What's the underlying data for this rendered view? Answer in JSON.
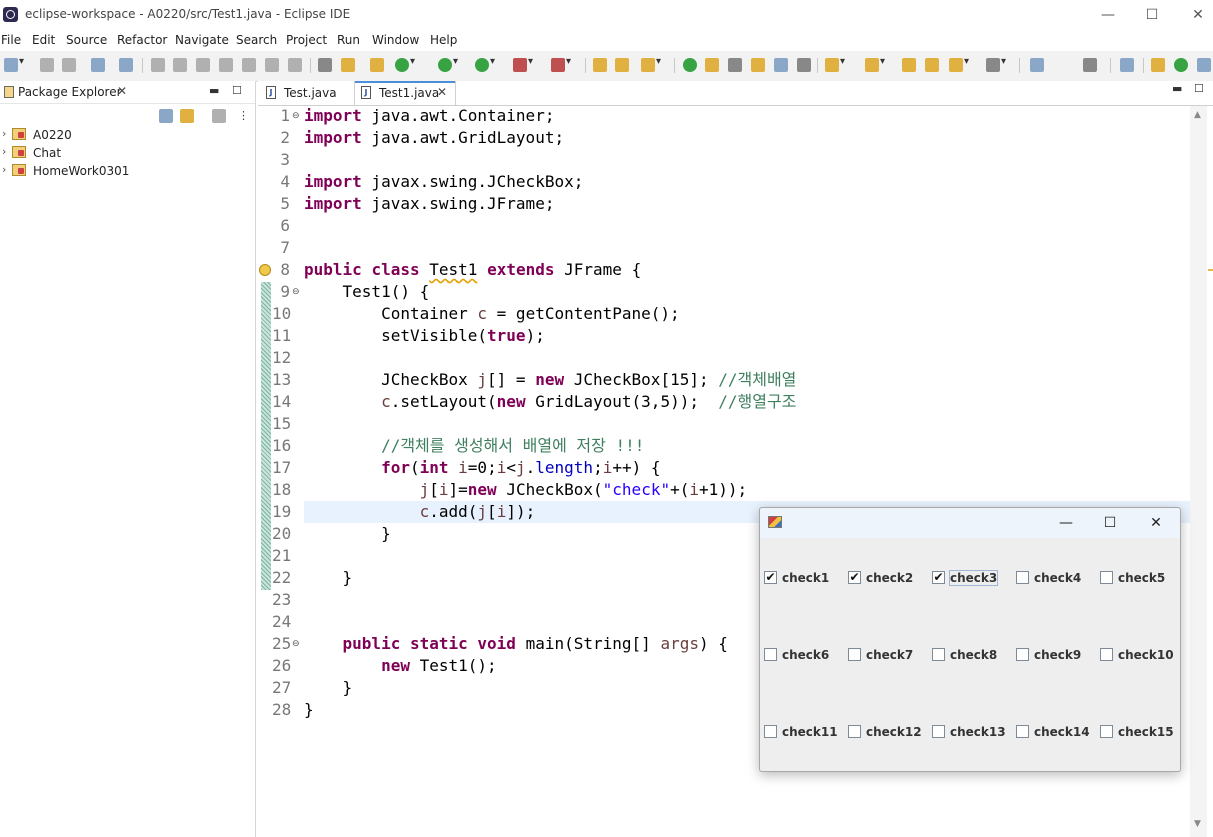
{
  "window": {
    "title": "eclipse-workspace - A0220/src/Test1.java - Eclipse IDE",
    "controls": {
      "minimize": "—",
      "maximize": "☐",
      "close": "✕"
    }
  },
  "menu": [
    "File",
    "Edit",
    "Source",
    "Refactor",
    "Navigate",
    "Search",
    "Project",
    "Run",
    "Window",
    "Help"
  ],
  "package_explorer": {
    "title": "Package Explorer",
    "projects": [
      "A0220",
      "Chat",
      "HomeWork0301"
    ]
  },
  "editor": {
    "tabs": [
      {
        "label": "Test.java",
        "active": false
      },
      {
        "label": "Test1.java",
        "active": true
      }
    ],
    "line_numbers": [
      "1",
      "2",
      "3",
      "4",
      "5",
      "6",
      "7",
      "8",
      "9",
      "10",
      "11",
      "12",
      "13",
      "14",
      "15",
      "16",
      "17",
      "18",
      "19",
      "20",
      "21",
      "22",
      "23",
      "24",
      "25",
      "26",
      "27",
      "28"
    ],
    "code": {
      "l1_kw": "import",
      "l1_rest": " java.awt.Container;",
      "l2_kw": "import",
      "l2_rest": " java.awt.GridLayout;",
      "l4_kw": "import",
      "l4_rest": " javax.swing.JCheckBox;",
      "l5_kw": "import",
      "l5_rest": " javax.swing.JFrame;",
      "l8_kw1": "public",
      "l8_kw2": "class",
      "l8_name": "Test1",
      "l8_kw3": "extends",
      "l8_rest": " JFrame {",
      "l9": "    Test1() {",
      "l10_a": "        Container ",
      "l10_var": "c",
      "l10_b": " = getContentPane();",
      "l11_a": "        setVisible(",
      "l11_kw": "true",
      "l11_b": ");",
      "l13_a": "        JCheckBox ",
      "l13_var": "j",
      "l13_b": "[] = ",
      "l13_kw": "new",
      "l13_c": " JCheckBox[15]; ",
      "l13_cm": "//객체배열",
      "l14_a": "        ",
      "l14_var": "c",
      "l14_b": ".setLayout(",
      "l14_kw": "new",
      "l14_c": " GridLayout(3,5));  ",
      "l14_cm": "//행열구조",
      "l16_cm": "        //객체를 생성해서 배열에 저장 !!!",
      "l17_a": "        ",
      "l17_kw1": "for",
      "l17_b": "(",
      "l17_kw2": "int",
      "l17_c": " ",
      "l17_v1": "i",
      "l17_d": "=0;",
      "l17_v2": "i",
      "l17_e": "<",
      "l17_v3": "j",
      "l17_f": ".",
      "l17_fld": "length",
      "l17_g": ";",
      "l17_v4": "i",
      "l17_h": "++) {",
      "l18_a": "            ",
      "l18_v1": "j",
      "l18_b": "[",
      "l18_v2": "i",
      "l18_c": "]=",
      "l18_kw": "new",
      "l18_d": " JCheckBox(",
      "l18_st": "\"check\"",
      "l18_e": "+(",
      "l18_v3": "i",
      "l18_f": "+1));",
      "l19_a": "            ",
      "l19_v1": "c",
      "l19_b": ".add(",
      "l19_v2": "j",
      "l19_c": "[",
      "l19_v3": "i",
      "l19_d": "]);",
      "l20": "        }",
      "l22": "    }",
      "l25_a": "    ",
      "l25_kw1": "public",
      "l25_b": " ",
      "l25_kw2": "static",
      "l25_c": " ",
      "l25_kw3": "void",
      "l25_d": " main(String[] ",
      "l25_var": "args",
      "l25_e": ") {",
      "l26_a": "        ",
      "l26_kw": "new",
      "l26_b": " Test1();",
      "l27": "    }",
      "l28": "}"
    }
  },
  "swing_window": {
    "controls": {
      "minimize": "—",
      "maximize": "☐",
      "close": "✕"
    },
    "checkboxes": [
      {
        "label": "check1",
        "checked": true
      },
      {
        "label": "check2",
        "checked": true
      },
      {
        "label": "check3",
        "checked": true
      },
      {
        "label": "check4",
        "checked": false
      },
      {
        "label": "check5",
        "checked": false
      },
      {
        "label": "check6",
        "checked": false
      },
      {
        "label": "check7",
        "checked": false
      },
      {
        "label": "check8",
        "checked": false
      },
      {
        "label": "check9",
        "checked": false
      },
      {
        "label": "check10",
        "checked": false
      },
      {
        "label": "check11",
        "checked": false
      },
      {
        "label": "check12",
        "checked": false
      },
      {
        "label": "check13",
        "checked": false
      },
      {
        "label": "check14",
        "checked": false
      },
      {
        "label": "check15",
        "checked": false
      }
    ],
    "check_glyph": "✔"
  },
  "colors": {
    "keyword": "#7f0055",
    "comment": "#3f7f5f",
    "string": "#2a00ff",
    "field": "#0000c0",
    "current_line": "#e8f2fe"
  }
}
